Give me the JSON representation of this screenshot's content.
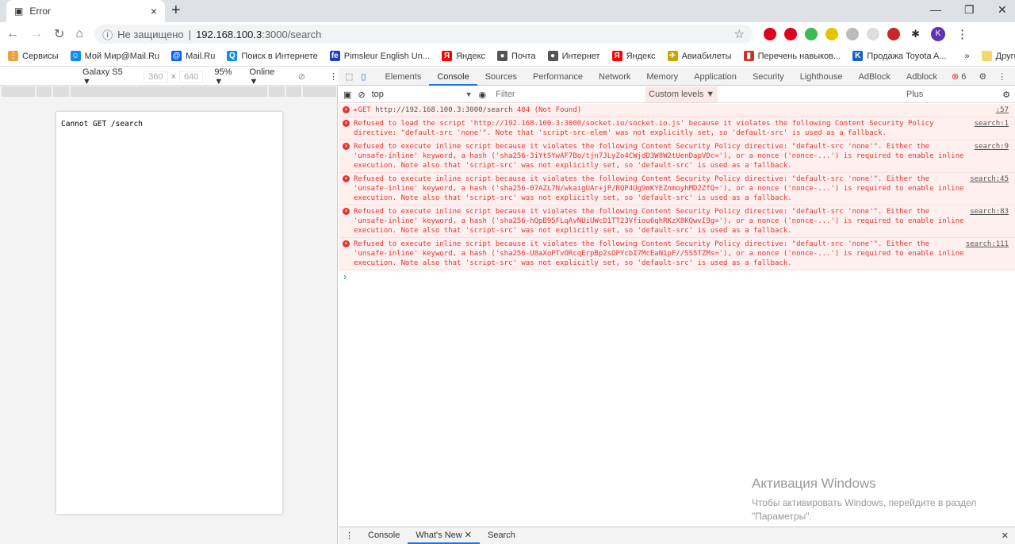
{
  "browser": {
    "tab_title": "Error",
    "security_label": "Не защищено",
    "url_host": "192.168.100.3",
    "url_rest": ":3000/search",
    "extensions": [
      {
        "name": "opera",
        "color": "#e0001b"
      },
      {
        "name": "abp",
        "color": "#e0001b"
      },
      {
        "name": "shield",
        "color": "#3cba54"
      },
      {
        "name": "yandex-plus",
        "color": "#e6c300"
      },
      {
        "name": "grey-ext",
        "color": "#bbb"
      },
      {
        "name": "grey-ext-2",
        "color": "#ddd"
      },
      {
        "name": "red-ext",
        "color": "#c62828"
      }
    ],
    "profile_initial": "K"
  },
  "bookmarks": [
    {
      "label": "Сервисы",
      "color": "#e8a33d",
      "glyph": "⋮"
    },
    {
      "label": "Мой Мир@Mail.Ru",
      "color": "#168de2",
      "glyph": "☺"
    },
    {
      "label": "Mail.Ru",
      "color": "#005ff9",
      "glyph": "@"
    },
    {
      "label": "Поиск в Интернете",
      "color": "#168de2",
      "glyph": "Q"
    },
    {
      "label": "Pimsleur English Un...",
      "color": "#1a3fbf",
      "glyph": "fe"
    },
    {
      "label": "Яндекс",
      "color": "#f00",
      "glyph": "Я"
    },
    {
      "label": "Почта",
      "color": "#555",
      "glyph": "●"
    },
    {
      "label": "Интернет",
      "color": "#555",
      "glyph": "●"
    },
    {
      "label": "Яндекс",
      "color": "#f00",
      "glyph": "Я"
    },
    {
      "label": "Авиабилеты",
      "color": "#c9a400",
      "glyph": "✈"
    },
    {
      "label": "Перечень навыков...",
      "color": "#c0392b",
      "glyph": "▮"
    },
    {
      "label": "Продажа Toyota A...",
      "color": "#1565c0",
      "glyph": "K"
    }
  ],
  "bookmarks_more": "»",
  "other_bookmarks": "Другие закладки",
  "device_toolbar": {
    "device": "Galaxy S5 ▼",
    "width": "360",
    "x": "×",
    "height": "640",
    "zoom": "95% ▼",
    "network": "Online ▼"
  },
  "page": {
    "text": "Cannot GET /search"
  },
  "devtools": {
    "tabs": [
      "Elements",
      "Console",
      "Sources",
      "Performance",
      "Network",
      "Memory",
      "Application",
      "Security",
      "Lighthouse",
      "AdBlock",
      "Adblock Plus"
    ],
    "active_tab": "Console",
    "error_count": "6",
    "context": "top",
    "filter_placeholder": "Filter",
    "levels": "Custom levels ▼",
    "messages": [
      {
        "text": "▸GET ",
        "link": "http://192.168.100.3:3000/search",
        "after": " 404 (Not Found)",
        "source": ":57"
      },
      {
        "text": "Refused to load the script '",
        "link": "http://192.168.100.3:3000/socket.io/socket.io.js",
        "after": "' because it violates the following Content Security Policy directive: \"default-src 'none'\". Note that 'script-src-elem' was not explicitly set, so 'default-src' is used as a fallback.",
        "source": "search:1"
      },
      {
        "text": "Refused to execute inline script because it violates the following Content Security Policy directive: \"default-src 'none'\". Either the 'unsafe-inline' keyword, a hash ('sha256-3iYtSYwAF7Bo/tjn7JLyZo4CWjdD3W8W2tUenDapVDc='), or a nonce ('nonce-...') is required to enable inline execution. Note also that 'script-src' was not explicitly set, so 'default-src' is used as a fallback.",
        "source": "search:9"
      },
      {
        "text": "Refused to execute inline script because it violates the following Content Security Policy directive: \"default-src 'none'\". Either the 'unsafe-inline' keyword, a hash ('sha256-07AZL7N/wkaigUAr+jP/RQP4Ug9mKYEZnmoyhMD2ZfQ='), or a nonce ('nonce-...') is required to enable inline execution. Note also that 'script-src' was not explicitly set, so 'default-src' is used as a fallback.",
        "source": "search:45"
      },
      {
        "text": "Refused to execute inline script because it violates the following Content Security Policy directive: \"default-src 'none'\". Either the 'unsafe-inline' keyword, a hash ('sha256-hQpB95FLqAvNUiUWcD1TT23Vfiou6qhRKzX8KQwvI9g='), or a nonce ('nonce-...') is required to enable inline execution. Note also that 'script-src' was not explicitly set, so 'default-src' is used as a fallback.",
        "source": "search:83"
      },
      {
        "text": "Refused to execute inline script because it violates the following Content Security Policy directive: \"default-src 'none'\". Either the 'unsafe-inline' keyword, a hash ('sha256-U8aXoPTvORcqErpBp2sOPYcbI7McEaN1pF//SS5TZMs='), or a nonce ('nonce-...') is required to enable inline execution. Note also that 'script-src' was not explicitly set, so 'default-src' is used as a fallback.",
        "source": "search:111"
      }
    ],
    "prompt": "›",
    "drawer_tabs": [
      "Console",
      "What's New",
      "Search"
    ],
    "drawer_active": "What's New"
  },
  "watermark": {
    "title": "Активация Windows",
    "line1": "Чтобы активировать Windows, перейдите в раздел",
    "line2": "\"Параметры\"."
  }
}
